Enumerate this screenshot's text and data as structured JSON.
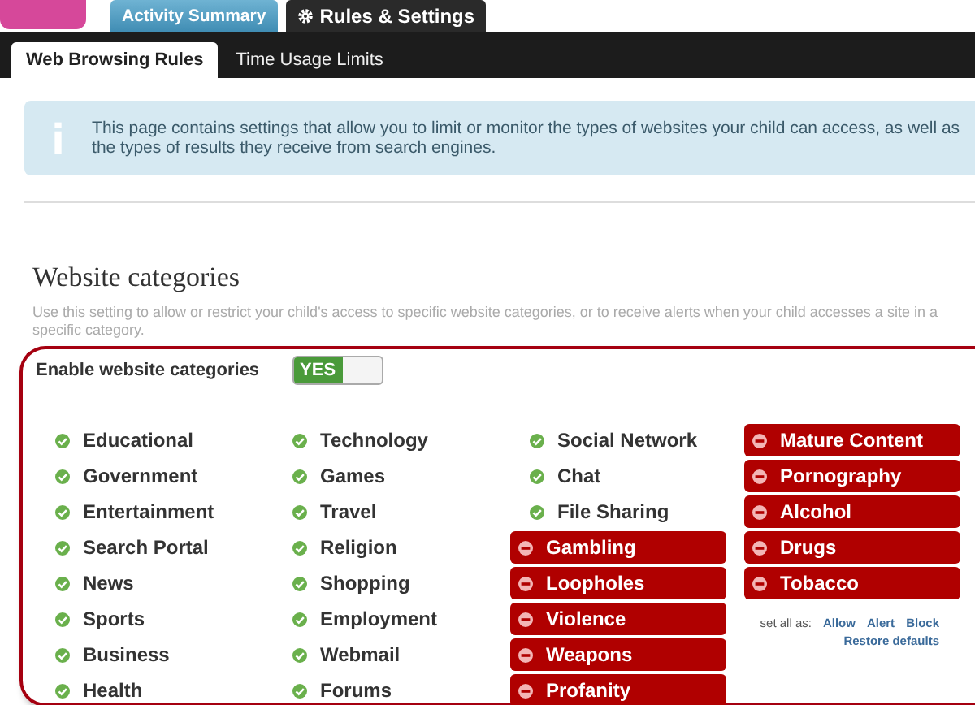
{
  "tabs": [
    {
      "label": "Activity Summary",
      "selected": false,
      "icon": false
    },
    {
      "label": "Rules & Settings",
      "selected": true,
      "icon": true
    }
  ],
  "subtabs": [
    {
      "label": "Web Browsing Rules",
      "selected": true
    },
    {
      "label": "Time Usage Limits",
      "selected": false
    }
  ],
  "info": "This page contains settings that allow you to limit or monitor the types of websites your child can access, as well as the types of results they receive from search engines.",
  "section": {
    "title": "Website categories",
    "description": "Use this setting to allow or restrict your child's access to specific website categories, or to receive alerts when your child accesses a site in a specific category.",
    "enable": {
      "label": "Enable website categories",
      "toggle": "YES",
      "on": true
    },
    "columns": [
      [
        {
          "label": "Educational",
          "blocked": false
        },
        {
          "label": "Government",
          "blocked": false
        },
        {
          "label": "Entertainment",
          "blocked": false
        },
        {
          "label": "Search Portal",
          "blocked": false
        },
        {
          "label": "News",
          "blocked": false
        },
        {
          "label": "Sports",
          "blocked": false
        },
        {
          "label": "Business",
          "blocked": false
        },
        {
          "label": "Health",
          "blocked": false
        }
      ],
      [
        {
          "label": "Technology",
          "blocked": false
        },
        {
          "label": "Games",
          "blocked": false
        },
        {
          "label": "Travel",
          "blocked": false
        },
        {
          "label": "Religion",
          "blocked": false
        },
        {
          "label": "Shopping",
          "blocked": false
        },
        {
          "label": "Employment",
          "blocked": false
        },
        {
          "label": "Webmail",
          "blocked": false
        },
        {
          "label": "Forums",
          "blocked": false
        }
      ],
      [
        {
          "label": "Social Network",
          "blocked": false
        },
        {
          "label": "Chat",
          "blocked": false
        },
        {
          "label": "File Sharing",
          "blocked": false
        },
        {
          "label": "Gambling",
          "blocked": true
        },
        {
          "label": "Loopholes",
          "blocked": true
        },
        {
          "label": "Violence",
          "blocked": true
        },
        {
          "label": "Weapons",
          "blocked": true
        },
        {
          "label": "Profanity",
          "blocked": true
        }
      ],
      [
        {
          "label": "Mature Content",
          "blocked": true
        },
        {
          "label": "Pornography",
          "blocked": true
        },
        {
          "label": "Alcohol",
          "blocked": true
        },
        {
          "label": "Drugs",
          "blocked": true
        },
        {
          "label": "Tobacco",
          "blocked": true
        }
      ]
    ],
    "set_all": {
      "label": "set all as:",
      "options": [
        "Allow",
        "Alert",
        "Block"
      ],
      "restore": "Restore defaults"
    }
  }
}
